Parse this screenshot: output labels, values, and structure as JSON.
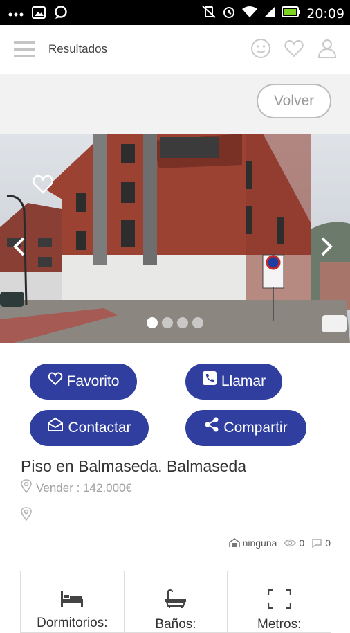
{
  "status_bar": {
    "time": "20:09",
    "icons": [
      "more-dots-icon",
      "image-icon",
      "chat-icon",
      "vibrate-off-icon",
      "alarm-icon",
      "wifi-icon",
      "signal-icon",
      "battery-icon"
    ]
  },
  "app_bar": {
    "title": "Resultados",
    "icons": [
      "menu-icon",
      "smiley-icon",
      "heart-icon",
      "user-icon"
    ]
  },
  "back_button": {
    "label": "Volver"
  },
  "gallery": {
    "current_index": 1,
    "dot_count": 4,
    "icons": [
      "favorite-heart-outline-icon",
      "chevron-left-icon",
      "chevron-right-icon"
    ]
  },
  "actions": {
    "favorite": {
      "label": "Favorito",
      "icon": "heart-outline-icon"
    },
    "call": {
      "label": "Llamar",
      "icon": "phone-icon"
    },
    "contact": {
      "label": "Contactar",
      "icon": "envelope-icon"
    },
    "share": {
      "label": "Compartir",
      "icon": "share-icon"
    }
  },
  "listing": {
    "title": "Piso en Balmaseda. Balmaseda",
    "price_line": "Vender : 142.000€"
  },
  "meta": {
    "energy": "ninguna",
    "views": "0",
    "comments": "0"
  },
  "features": [
    {
      "label": "Dormitorios:",
      "icon": "bed-icon"
    },
    {
      "label": "Baños:",
      "icon": "bathtub-icon"
    },
    {
      "label": "Metros:",
      "icon": "expand-icon"
    }
  ],
  "colors": {
    "primary": "#303f9f",
    "muted": "#a0a0a0"
  }
}
